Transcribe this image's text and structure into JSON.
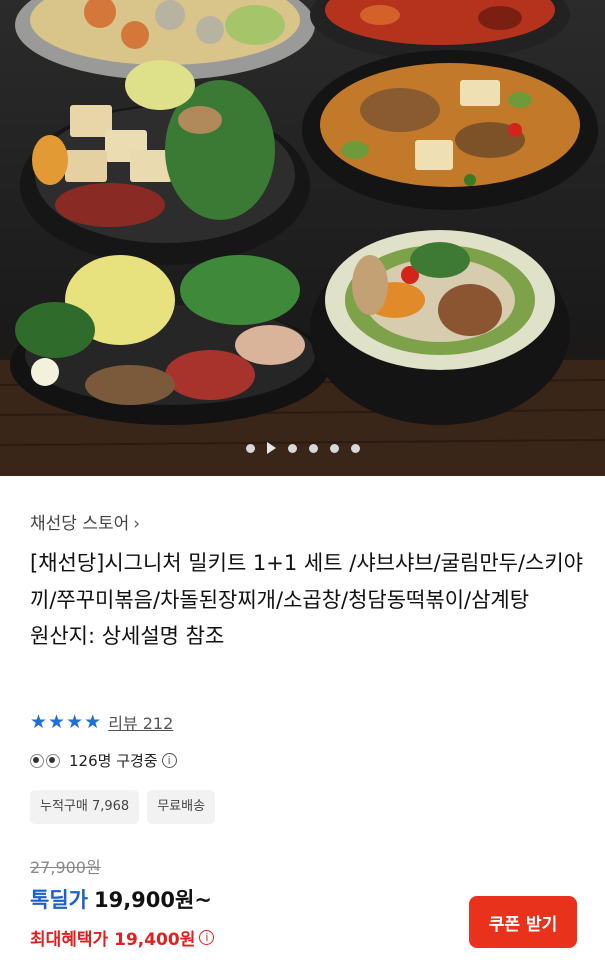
{
  "hero": {
    "carousel_dots": 6,
    "active_dot": 1
  },
  "store": {
    "name": "채선당 스토어",
    "chevron": "›"
  },
  "product": {
    "title": "[채선당]시그니처 밀키트 1+1 세트 /샤브샤브/굴림만두/스키야끼/쭈꾸미볶음/차돌된장찌개/소곱창/청담동떡볶이/삼계탕",
    "origin": "원산지: 상세설명 참조"
  },
  "rating": {
    "stars": 4,
    "review_label": "리뷰 212"
  },
  "viewers": {
    "text": "126명 구경중"
  },
  "chips": [
    "누적구매 7,968",
    "무료배송"
  ],
  "price": {
    "original": "27,900원",
    "deal_label": "톡딜가",
    "deal_price": "19,900원~",
    "max_benefit": "최대혜택가 19,400원"
  },
  "coupon_button": "쿠폰 받기",
  "colors": {
    "accent_blue": "#1b5fc9",
    "accent_red": "#e02020",
    "button_red": "#e8321c",
    "star_blue": "#1e6fd9"
  }
}
